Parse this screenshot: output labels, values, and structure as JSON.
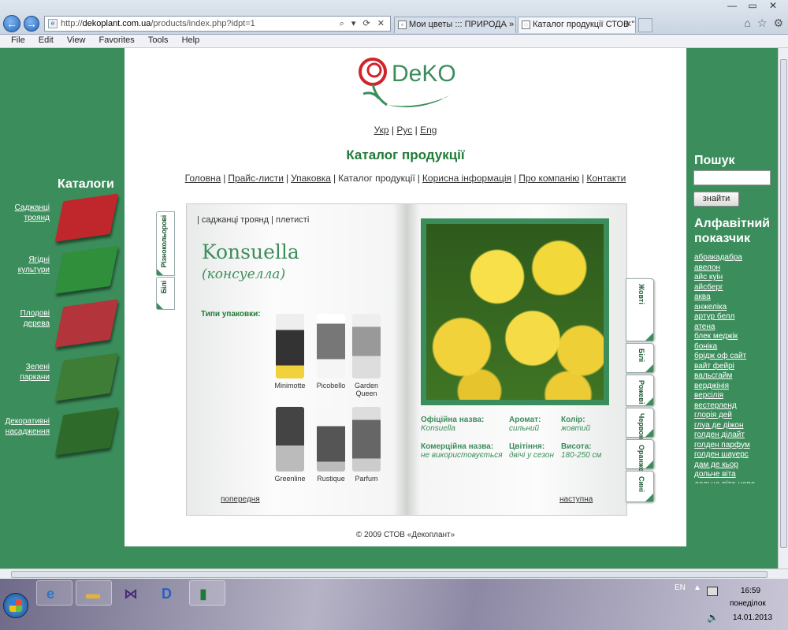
{
  "browser": {
    "url_prefix": "http://",
    "url_domain": "dekoplant.com.ua",
    "url_path": "/products/index.php?idpt=1",
    "url_tools": "⌕ ▾ ⟳ ✕",
    "tabs": [
      {
        "label": "Мои цветы ::: ПРИРОДА » Цв...",
        "active": false
      },
      {
        "label": "Каталог продукції СТОВ \"...",
        "active": true
      }
    ],
    "menu": [
      "File",
      "Edit",
      "View",
      "Favorites",
      "Tools",
      "Help"
    ]
  },
  "header": {
    "langs": [
      "Укр",
      "Рус",
      "Eng"
    ],
    "title": "Каталог продукції",
    "nav": [
      "Головна",
      "Прайс-листи",
      "Упаковка",
      "Каталог продукції",
      "Корисна інформація",
      "Про компанію",
      "Контакти"
    ]
  },
  "left_catalogs": {
    "title": "Каталоги",
    "items": [
      {
        "label_line1": "Саджанці",
        "label_line2": "троянд",
        "color": "#c0272d"
      },
      {
        "label_line1": "Ягідні",
        "label_line2": "культури",
        "color": "#2f8f3a"
      },
      {
        "label_line1": "Плодові",
        "label_line2": "дерева",
        "color": "#b3343a"
      },
      {
        "label_line1": "Зелені",
        "label_line2": "паркани",
        "color": "#3e7d36"
      },
      {
        "label_line1": "Декоративні",
        "label_line2": "насадження",
        "color": "#2e6b2a"
      }
    ]
  },
  "book": {
    "subnav": "| саджанці троянд | плетисті",
    "left_tabs": [
      "Різнокольорові",
      "Білі"
    ],
    "right_tabs": [
      "Жовті",
      "Білі",
      "Рожеві",
      "Червоні",
      "Оранжеві",
      "Сині"
    ],
    "plant_name": "Konsuella",
    "plant_sub": "(консуелла)",
    "pack_label": "Типи упаковки:",
    "packs": [
      "Minimotte",
      "Picobello",
      "Garden Queen",
      "Greenline",
      "Rustique",
      "Parfum"
    ],
    "official_label": "Офіційна назва:",
    "official_value": "Konsuella",
    "aroma_label": "Аромат:",
    "aroma_value": "сильний",
    "color_label": "Колір:",
    "color_value": "жовтий",
    "commercial_label": "Комерційна назва:",
    "commercial_value": "не використовується",
    "bloom_label": "Цвітіння:",
    "bloom_value": "двічі у сезон",
    "height_label": "Висота:",
    "height_value": "180-250 см",
    "prev": "попередня",
    "next": "наступна"
  },
  "copyright": "© 2009 СТОВ «Декоплант»",
  "search": {
    "title": "Пошук",
    "button": "знайти",
    "placeholder": ""
  },
  "alphabet": {
    "title_line1": "Алфавітний",
    "title_line2": "показчик",
    "items": [
      "абракадабра",
      "авелон",
      "айс куін",
      "айсберг",
      "аква",
      "анжеліка",
      "артур белл",
      "атена",
      "блек меджік",
      "боніка",
      "брідж оф сайт",
      "вайт фейрі",
      "вальсгайм",
      "верджінія",
      "версілія",
      "вестерленд",
      "глорія дей",
      "глуа де діжон",
      "голден ділайт",
      "голден парфум",
      "голден шауерс",
      "дам де кьор",
      "дольче віта",
      "дольче віта нова"
    ]
  },
  "taskbar": {
    "lang": "EN",
    "time": "16:59",
    "day": "понеділок",
    "date": "14.01.2013"
  },
  "colors": {
    "brand_green": "#3c8d5c",
    "title_green": "#1f7a36",
    "rose_red": "#d1232a"
  }
}
